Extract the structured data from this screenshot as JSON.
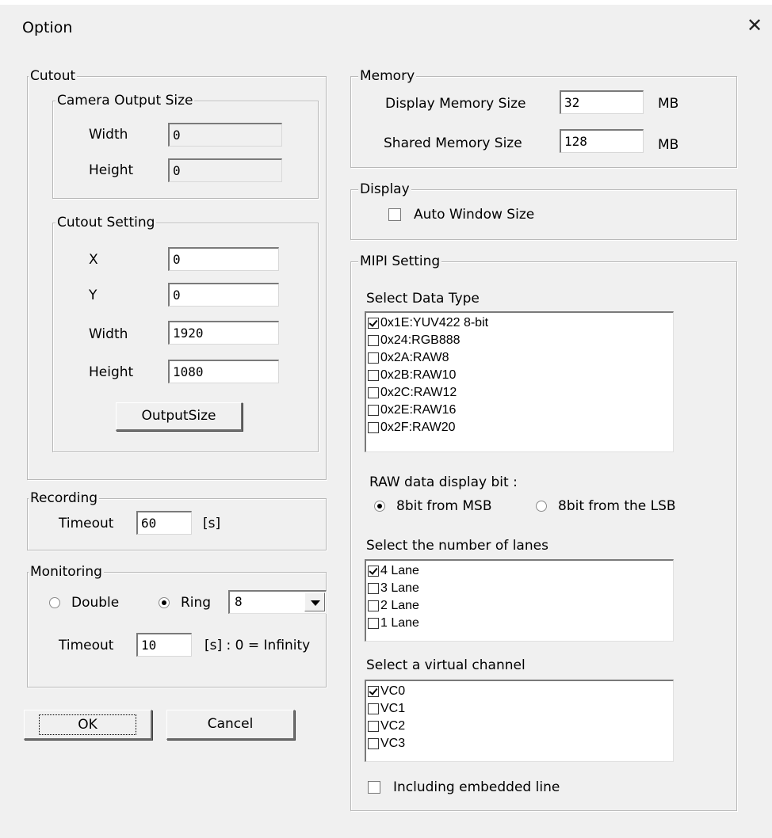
{
  "window": {
    "title": "Option",
    "close_glyph": "✕"
  },
  "cutout": {
    "legend": "Cutout",
    "camera_output": {
      "legend": "Camera Output Size",
      "width_label": "Width",
      "width_value": "0",
      "height_label": "Height",
      "height_value": "0"
    },
    "setting": {
      "legend": "Cutout Setting",
      "x_label": "X",
      "x_value": "0",
      "y_label": "Y",
      "y_value": "0",
      "width_label": "Width",
      "width_value": "1920",
      "height_label": "Height",
      "height_value": "1080",
      "output_button": "OutputSize"
    }
  },
  "recording": {
    "legend": "Recording",
    "timeout_label": "Timeout",
    "timeout_value": "60",
    "unit": "[s]"
  },
  "monitoring": {
    "legend": "Monitoring",
    "double_label": "Double",
    "ring_label": "Ring",
    "ring_selected": true,
    "ring_value": "8",
    "timeout_label": "Timeout",
    "timeout_value": "10",
    "unit": "[s] : 0 = Infinity"
  },
  "buttons": {
    "ok": "OK",
    "cancel": "Cancel"
  },
  "memory": {
    "legend": "Memory",
    "display_label": "Display Memory Size",
    "display_value": "32",
    "display_unit": "MB",
    "shared_label": "Shared Memory Size",
    "shared_value": "128",
    "shared_unit": "MB"
  },
  "display": {
    "legend": "Display",
    "auto_window_label": "Auto Window Size",
    "auto_window_checked": false
  },
  "mipi": {
    "legend": "MIPI Setting",
    "data_type_label": "Select Data Type",
    "data_types": [
      {
        "label": "0x1E:YUV422 8-bit",
        "checked": true
      },
      {
        "label": "0x24:RGB888",
        "checked": false
      },
      {
        "label": "0x2A:RAW8",
        "checked": false
      },
      {
        "label": "0x2B:RAW10",
        "checked": false
      },
      {
        "label": "0x2C:RAW12",
        "checked": false
      },
      {
        "label": "0x2E:RAW16",
        "checked": false
      },
      {
        "label": "0x2F:RAW20",
        "checked": false
      }
    ],
    "raw_bit_label": "RAW data display bit :",
    "raw_msb_label": "8bit from MSB",
    "raw_lsb_label": "8bit from the LSB",
    "raw_selected": "msb",
    "lanes_label": "Select the number of lanes",
    "lanes": [
      {
        "label": "4 Lane",
        "checked": true
      },
      {
        "label": "3 Lane",
        "checked": false
      },
      {
        "label": "2 Lane",
        "checked": false
      },
      {
        "label": "1 Lane",
        "checked": false
      }
    ],
    "vc_label": "Select a virtual channel",
    "virtual_channels": [
      {
        "label": "VC0",
        "checked": true
      },
      {
        "label": "VC1",
        "checked": false
      },
      {
        "label": "VC2",
        "checked": false
      },
      {
        "label": "VC3",
        "checked": false
      }
    ],
    "embedded_label": "Including embedded line",
    "embedded_checked": false
  }
}
